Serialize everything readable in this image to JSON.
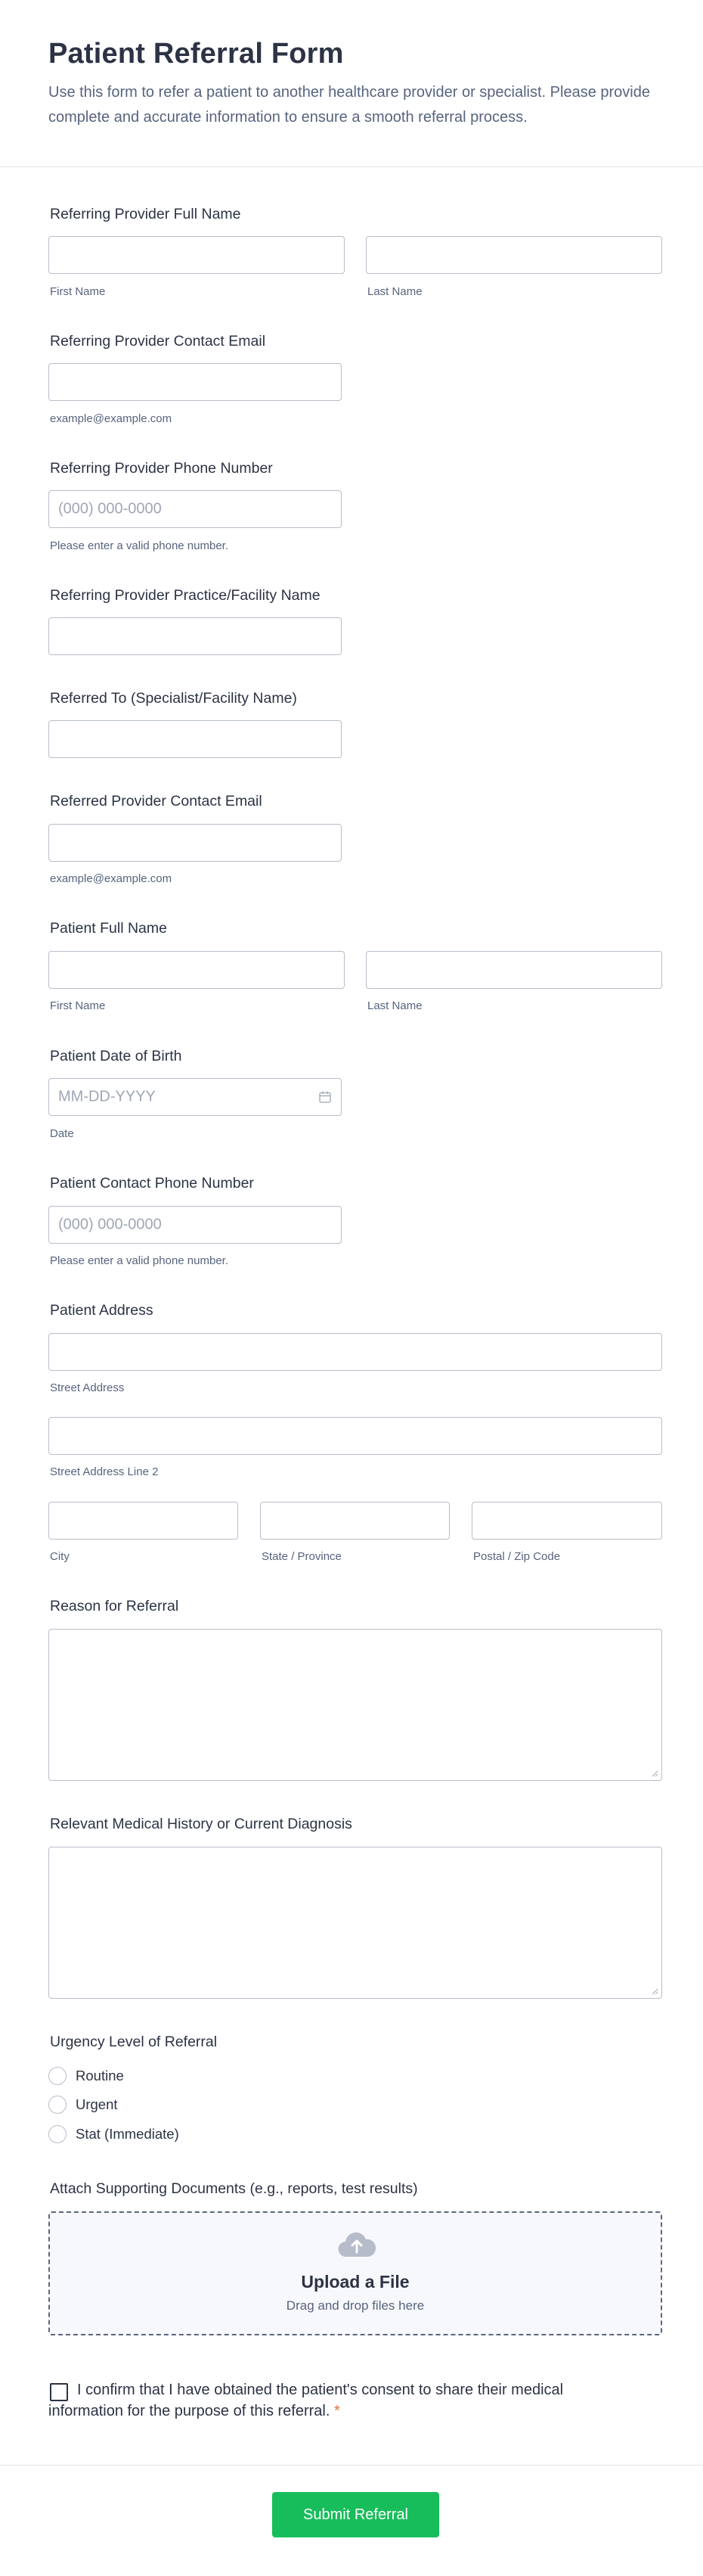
{
  "header": {
    "title": "Patient Referral Form",
    "description": "Use this form to refer a patient to another healthcare provider or specialist. Please provide complete and accurate information to ensure a smooth referral process."
  },
  "fields": {
    "ref_provider_name": {
      "label": "Referring Provider Full Name",
      "first_sub": "First Name",
      "last_sub": "Last Name",
      "first_value": "",
      "last_value": ""
    },
    "ref_provider_email": {
      "label": "Referring Provider Contact Email",
      "sub": "example@example.com",
      "value": ""
    },
    "ref_provider_phone": {
      "label": "Referring Provider Phone Number",
      "placeholder": "(000) 000-0000",
      "sub": "Please enter a valid phone number.",
      "value": ""
    },
    "ref_practice": {
      "label": "Referring Provider Practice/Facility Name",
      "value": ""
    },
    "referred_to": {
      "label": "Referred To (Specialist/Facility Name)",
      "value": ""
    },
    "referred_email": {
      "label": "Referred Provider Contact Email",
      "sub": "example@example.com",
      "value": ""
    },
    "patient_name": {
      "label": "Patient Full Name",
      "first_sub": "First Name",
      "last_sub": "Last Name",
      "first_value": "",
      "last_value": ""
    },
    "patient_dob": {
      "label": "Patient Date of Birth",
      "placeholder": "MM-DD-YYYY",
      "sub": "Date",
      "icon": "calendar-icon",
      "value": ""
    },
    "patient_phone": {
      "label": "Patient Contact Phone Number",
      "placeholder": "(000) 000-0000",
      "sub": "Please enter a valid phone number.",
      "value": ""
    },
    "patient_address": {
      "label": "Patient Address",
      "street_sub": "Street Address",
      "street2_sub": "Street Address Line 2",
      "city_sub": "City",
      "state_sub": "State / Province",
      "zip_sub": "Postal / Zip Code"
    },
    "reason": {
      "label": "Reason for Referral",
      "value": ""
    },
    "history": {
      "label": "Relevant Medical History or Current Diagnosis",
      "value": ""
    },
    "urgency": {
      "label": "Urgency Level of Referral",
      "options": [
        "Routine",
        "Urgent",
        "Stat (Immediate)"
      ],
      "selected": null
    },
    "attachments": {
      "label": "Attach Supporting Documents (e.g., reports, test results)",
      "icon": "cloud-upload-icon",
      "title": "Upload a File",
      "subtitle": "Drag and drop files here"
    },
    "consent": {
      "text": "I confirm that I have obtained the patient's consent to share their medical information for the purpose of this referral.",
      "required_mark": "*",
      "checked": false
    }
  },
  "submit_label": "Submit Referral",
  "colors": {
    "accent": "#18bd5b",
    "text": "#2c3345",
    "subtext": "#57647e",
    "border": "#b8bdc9",
    "required": "#e36f3c"
  }
}
